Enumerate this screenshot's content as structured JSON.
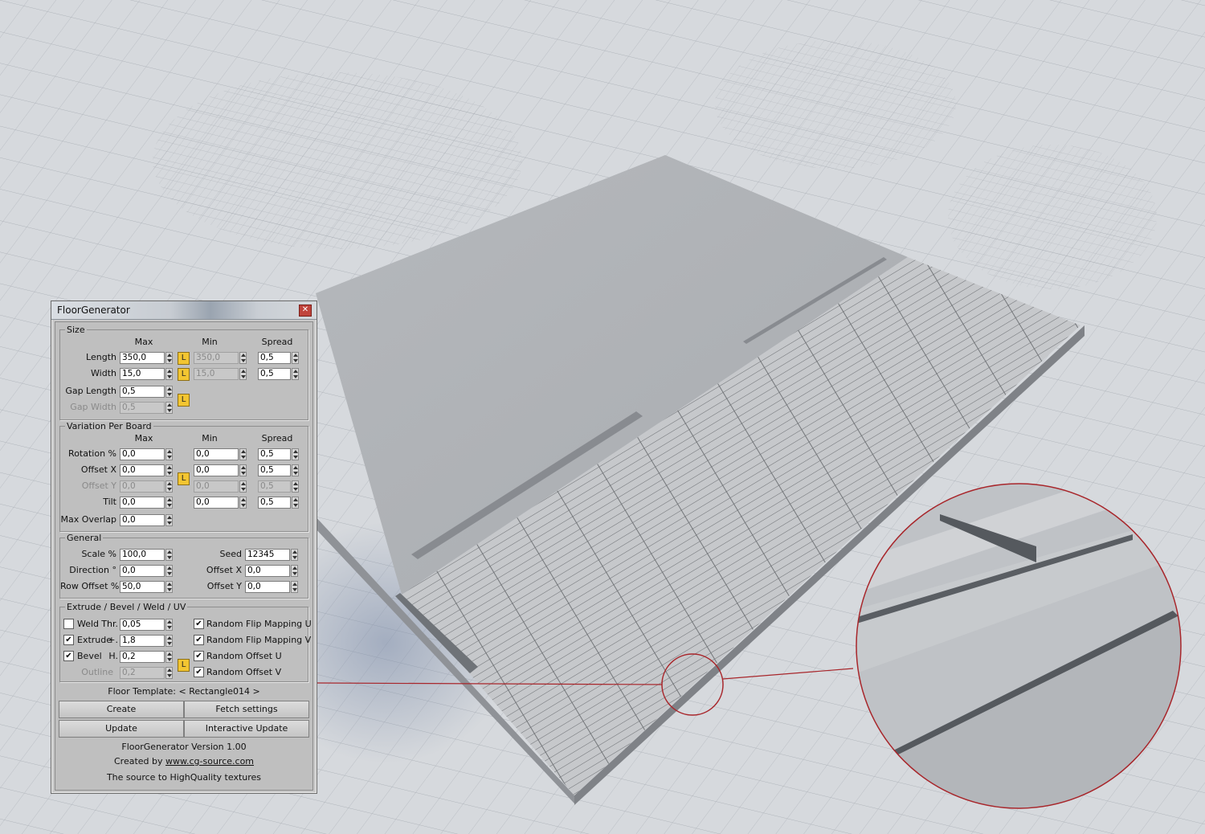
{
  "dialog": {
    "title": "FloorGenerator",
    "close_icon": "close-icon",
    "size": {
      "legend": "Size",
      "headers": {
        "max": "Max",
        "min": "Min",
        "spread": "Spread"
      },
      "length": {
        "label": "Length",
        "max": "350,0",
        "min": "350,0",
        "spread": "0,5",
        "lock": "L"
      },
      "width": {
        "label": "Width",
        "max": "15,0",
        "min": "15,0",
        "spread": "0,5",
        "lock": "L"
      },
      "gap_length": {
        "label": "Gap Length",
        "value": "0,5"
      },
      "gap_width": {
        "label": "Gap Width",
        "value": "0,5"
      },
      "gap_lock": "L"
    },
    "variation": {
      "legend": "Variation Per Board",
      "headers": {
        "max": "Max",
        "min": "Min",
        "spread": "Spread"
      },
      "rotation": {
        "label": "Rotation %",
        "max": "0,0",
        "min": "0,0",
        "spread": "0,5"
      },
      "offset_x": {
        "label": "Offset X",
        "max": "0,0",
        "min": "0,0",
        "spread": "0,5"
      },
      "offset_y": {
        "label": "Offset Y",
        "max": "0,0",
        "min": "0,0",
        "spread": "0,5"
      },
      "tilt": {
        "label": "Tilt",
        "max": "0,0",
        "min": "0,0",
        "spread": "0,5"
      },
      "max_overlap": {
        "label": "Max Overlap",
        "value": "0,0"
      },
      "lock": "L"
    },
    "general": {
      "legend": "General",
      "scale": {
        "label": "Scale %",
        "value": "100,0"
      },
      "direction": {
        "label": "Direction °",
        "value": "0,0"
      },
      "row_offset": {
        "label": "Row Offset %",
        "value": "50,0"
      },
      "seed": {
        "label": "Seed",
        "value": "12345"
      },
      "offset_x": {
        "label": "Offset X",
        "value": "0,0"
      },
      "offset_y": {
        "label": "Offset Y",
        "value": "0,0"
      }
    },
    "extrude": {
      "legend": "Extrude / Bevel / Weld / UV",
      "weld": {
        "label": "Weld",
        "param": "Thr.",
        "value": "0,05",
        "checked": false
      },
      "extrude": {
        "label": "Extrude",
        "param": "+.",
        "value": "1,8",
        "checked": true
      },
      "bevel": {
        "label": "Bevel",
        "param": "H.",
        "value": "0,2",
        "checked": true
      },
      "outline": {
        "label": "Outline",
        "value": "0,2"
      },
      "lock": "L",
      "flip_u": {
        "label": "Random Flip Mapping U",
        "checked": true
      },
      "flip_v": {
        "label": "Random Flip Mapping V",
        "checked": true
      },
      "offset_u": {
        "label": "Random Offset U",
        "checked": true
      },
      "offset_v": {
        "label": "Random Offset V",
        "checked": true
      },
      "check_mark": "✔"
    },
    "template_label": "Floor Template: < Rectangle014 >",
    "buttons": {
      "create": "Create",
      "fetch": "Fetch settings",
      "update": "Update",
      "interactive": "Interactive Update"
    },
    "footer": {
      "version": "FloorGenerator Version 1.00",
      "created_by": "Created by ",
      "link": "www.cg-source.com",
      "tagline": "The source to HighQuality textures"
    }
  }
}
